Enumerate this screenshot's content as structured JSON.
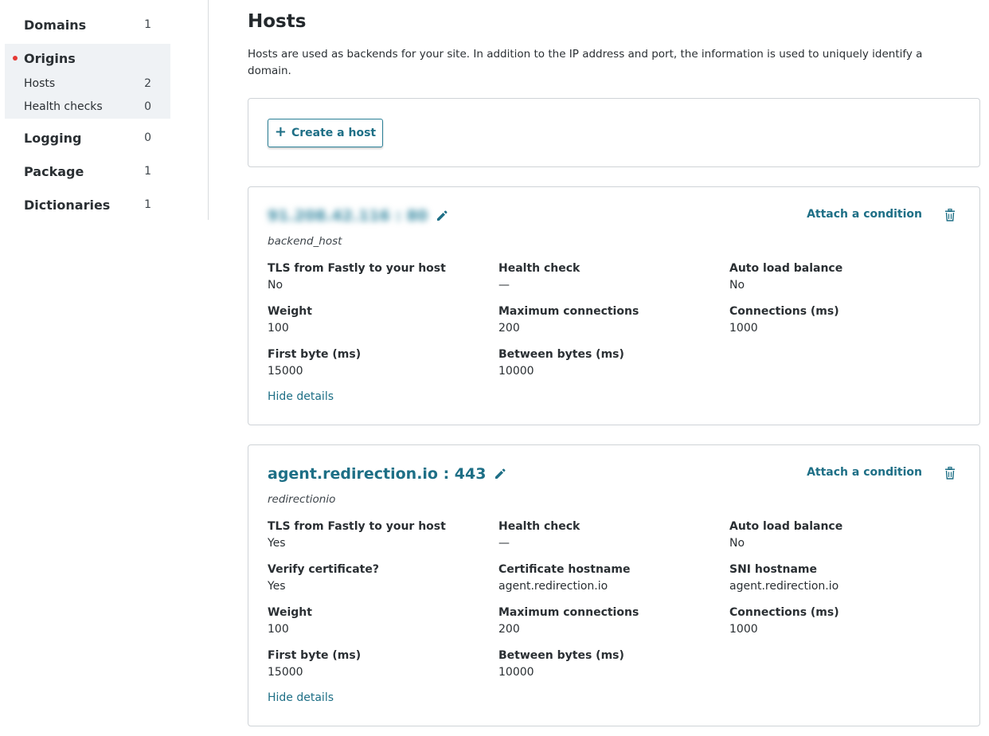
{
  "sidebar": {
    "items": [
      {
        "label": "Domains",
        "count": "1"
      },
      {
        "label": "Origins",
        "count": ""
      },
      {
        "label": "Logging",
        "count": "0"
      },
      {
        "label": "Package",
        "count": "1"
      },
      {
        "label": "Dictionaries",
        "count": "1"
      }
    ],
    "origins_sub": [
      {
        "label": "Hosts",
        "count": "2"
      },
      {
        "label": "Health checks",
        "count": "0"
      }
    ],
    "active_indicator_color": "#e53935"
  },
  "main": {
    "title": "Hosts",
    "description": "Hosts are used as backends for your site. In addition to the IP address and port, the information is used to uniquely identify a domain.",
    "create_button_label": "Create a host",
    "hosts": [
      {
        "address": "91.208.42.116 : 80",
        "address_obscured": true,
        "name": "backend_host",
        "attach_label": "Attach a condition",
        "hide_label": "Hide details",
        "fields": [
          {
            "label": "TLS from Fastly to your host",
            "value": "No"
          },
          {
            "label": "Health check",
            "value": "—"
          },
          {
            "label": "Auto load balance",
            "value": "No"
          },
          {
            "label": "Weight",
            "value": "100"
          },
          {
            "label": "Maximum connections",
            "value": "200"
          },
          {
            "label": "Connections (ms)",
            "value": "1000"
          },
          {
            "label": "First byte (ms)",
            "value": "15000"
          },
          {
            "label": "Between bytes (ms)",
            "value": "10000"
          }
        ]
      },
      {
        "address": "agent.redirection.io : 443",
        "address_obscured": false,
        "name": "redirectionio",
        "attach_label": "Attach a condition",
        "hide_label": "Hide details",
        "fields": [
          {
            "label": "TLS from Fastly to your host",
            "value": "Yes"
          },
          {
            "label": "Health check",
            "value": "—"
          },
          {
            "label": "Auto load balance",
            "value": "No"
          },
          {
            "label": "Verify certificate?",
            "value": "Yes"
          },
          {
            "label": "Certificate hostname",
            "value": "agent.redirection.io"
          },
          {
            "label": "SNI hostname",
            "value": "agent.redirection.io"
          },
          {
            "label": "Weight",
            "value": "100"
          },
          {
            "label": "Maximum connections",
            "value": "200"
          },
          {
            "label": "Connections (ms)",
            "value": "1000"
          },
          {
            "label": "First byte (ms)",
            "value": "15000"
          },
          {
            "label": "Between bytes (ms)",
            "value": "10000"
          }
        ]
      }
    ]
  },
  "colors": {
    "accent": "#1e6f86",
    "sidebar_active_bg": "#eff2f5",
    "border": "#cfd3d7"
  },
  "icons": {
    "create": "plus-icon",
    "edit": "pencil-icon",
    "delete": "trash-icon"
  }
}
